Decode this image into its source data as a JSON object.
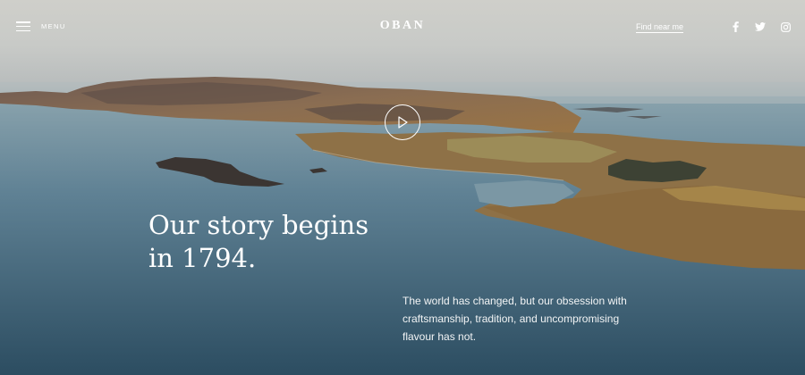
{
  "header": {
    "menu_label": "MENU",
    "logo_text": "OBAN",
    "find_link": "Find near me",
    "social": [
      "facebook-icon",
      "twitter-icon",
      "instagram-icon"
    ]
  },
  "hero": {
    "headline_line1": "Our story begins",
    "headline_line2": "in 1794.",
    "subtext": "The world has changed, but our obsession with craftsmanship, tradition, and uncompromising flavour has not.",
    "play_icon": "play-icon"
  },
  "colors": {
    "text": "#ffffff",
    "sky": "#cfcfca",
    "water": "#3f6376",
    "land": "#8a6a4a"
  }
}
